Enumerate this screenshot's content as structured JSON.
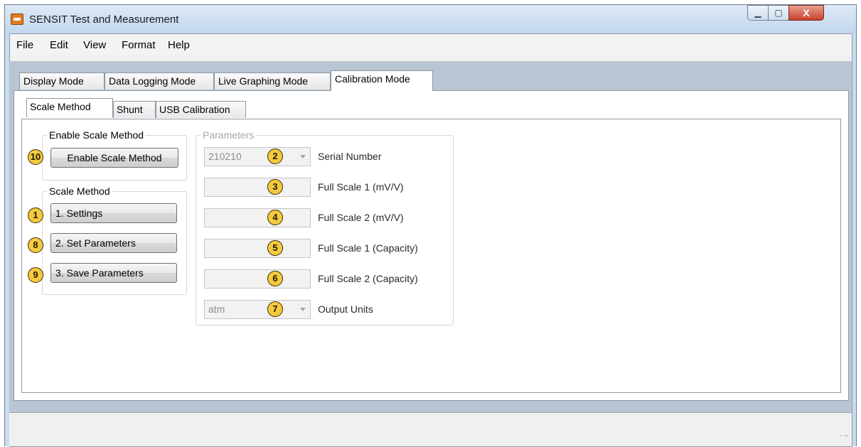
{
  "window": {
    "title": "SENSIT Test and Measurement",
    "minimize_glyph": "▁",
    "maximize_glyph": "▢",
    "close_glyph": "X"
  },
  "menu": [
    "File",
    "Edit",
    "View",
    "Format",
    "Help"
  ],
  "tabs": [
    "Display Mode",
    "Data Logging Mode",
    "Live Graphing Mode",
    "Calibration Mode"
  ],
  "active_tab": "Calibration Mode",
  "subtabs": [
    "Scale Method",
    "Shunt",
    "USB Calibration"
  ],
  "active_subtab": "Scale Method",
  "enable_group": {
    "title": "Enable Scale Method",
    "button": "Enable Scale Method",
    "badge": "10"
  },
  "scale_group": {
    "title": "Scale Method",
    "buttons": [
      {
        "label": "1. Settings",
        "badge": "1"
      },
      {
        "label": "2. Set Parameters",
        "badge": "8"
      },
      {
        "label": "3. Save Parameters",
        "badge": "9"
      }
    ]
  },
  "parameters": {
    "title": "Parameters",
    "rows": [
      {
        "value": "210210",
        "label": "Serial Number",
        "badge": "2"
      },
      {
        "value": "",
        "label": "Full Scale 1 (mV/V)",
        "badge": "3"
      },
      {
        "value": "",
        "label": "Full Scale 2 (mV/V)",
        "badge": "4"
      },
      {
        "value": "",
        "label": "Full Scale 1 (Capacity)",
        "badge": "5"
      },
      {
        "value": "",
        "label": "Full Scale 2 (Capacity)",
        "badge": "6"
      },
      {
        "value": "atm",
        "label": "Output Units",
        "badge": "7"
      }
    ]
  },
  "colors": {
    "badge": "#f4c93f",
    "titlebar": "#c3d7ee",
    "close": "#c7432c"
  }
}
